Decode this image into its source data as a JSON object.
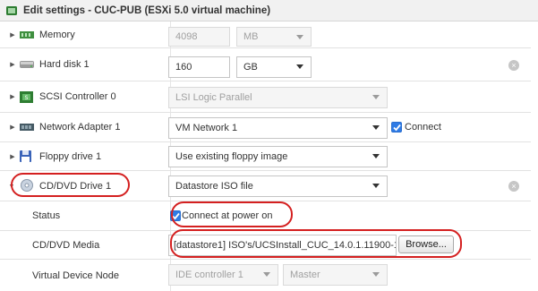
{
  "window": {
    "title": "Edit settings - CUC-PUB (ESXi 5.0 virtual machine)"
  },
  "rows": {
    "memory": {
      "label": "Memory",
      "value": "4098",
      "unit": "MB"
    },
    "hard_disk": {
      "label": "Hard disk 1",
      "value": "160",
      "unit": "GB"
    },
    "scsi": {
      "label": "SCSI Controller 0",
      "value": "LSI Logic Parallel"
    },
    "network": {
      "label": "Network Adapter 1",
      "value": "VM Network 1",
      "connect_label": "Connect",
      "connect_checked": true
    },
    "floppy": {
      "label": "Floppy drive 1",
      "value": "Use existing floppy image"
    },
    "cdrom": {
      "label": "CD/DVD Drive 1",
      "value": "Datastore ISO file"
    },
    "status": {
      "label": "Status",
      "checkbox_label": "Connect at power on",
      "checked": true
    },
    "media": {
      "label": "CD/DVD Media",
      "value": "[datastore1] ISO's/UCSInstall_CUC_14.0.1.11900-128",
      "browse_label": "Browse..."
    },
    "vdn": {
      "label": "Virtual Device Node",
      "controller": "IDE controller 1",
      "position": "Master"
    }
  },
  "colors": {
    "accent": "#2f7be5",
    "highlight": "#d42020"
  }
}
